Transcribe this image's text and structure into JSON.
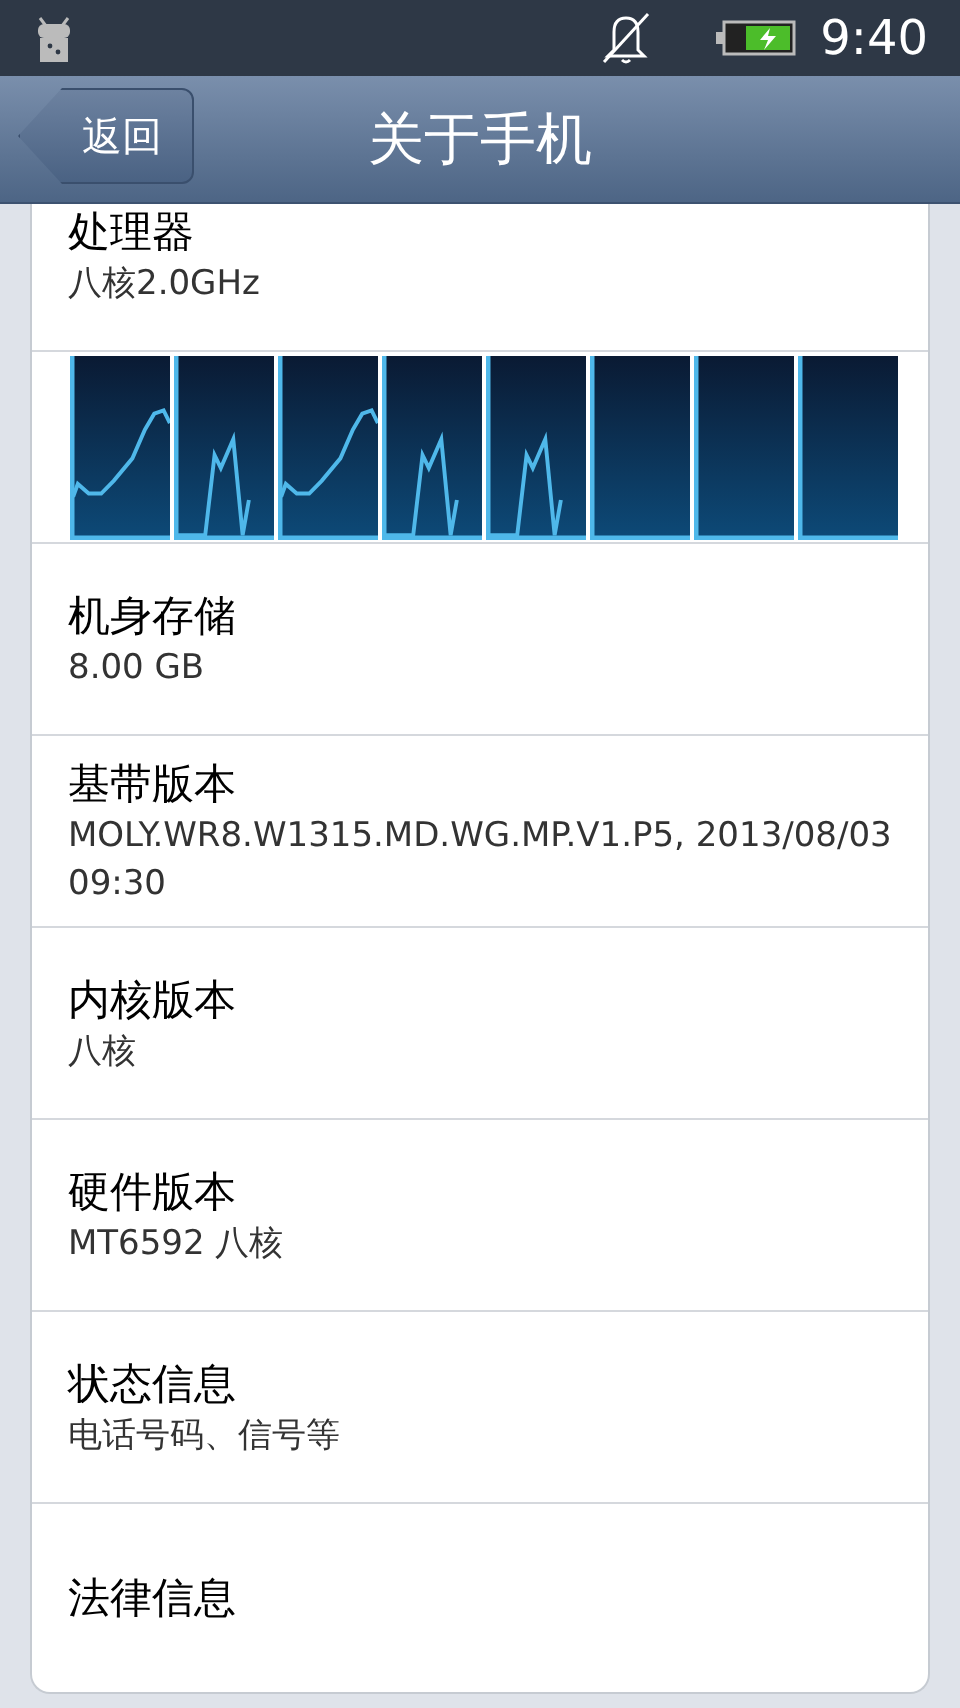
{
  "status_bar": {
    "time": "9:40"
  },
  "header": {
    "back": "返回",
    "title": "关于手机"
  },
  "items": [
    {
      "kind": "info",
      "title": "处理器",
      "value": "八核2.0GHz"
    },
    {
      "kind": "cpu_graph",
      "cores": [
        {
          "kind": "curve"
        },
        {
          "kind": "spike"
        },
        {
          "kind": "curve"
        },
        {
          "kind": "spike"
        },
        {
          "kind": "spike"
        },
        {
          "kind": "idle"
        },
        {
          "kind": "idle"
        },
        {
          "kind": "idle"
        }
      ]
    },
    {
      "kind": "info",
      "title": "机身存储",
      "value": "8.00 GB"
    },
    {
      "kind": "info",
      "title": "基带版本",
      "value": "MOLY.WR8.W1315.MD.WG.MP.V1.P5, 2013/08/03 09:30"
    },
    {
      "kind": "info",
      "title": "内核版本",
      "value": "八核"
    },
    {
      "kind": "info",
      "title": "硬件版本",
      "value": "MT6592 八核"
    },
    {
      "kind": "info",
      "title": "状态信息",
      "value": "电话号码、信号等"
    },
    {
      "kind": "info",
      "title": "法律信息"
    }
  ]
}
